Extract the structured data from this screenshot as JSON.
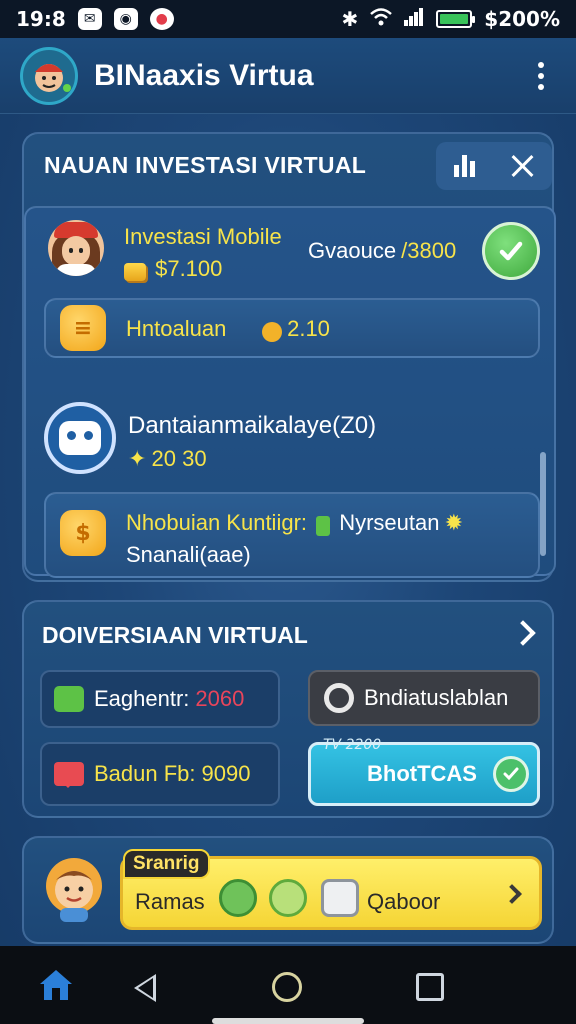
{
  "status_bar": {
    "time": "19:8",
    "battery": "$200%",
    "battery_level": 1.0
  },
  "app_bar": {
    "title": "BINaaxis Virtua"
  },
  "investment_panel": {
    "title": "NAUAN INVESTASI VIRTUAL",
    "main_card": {
      "name": "Investasi Mobile",
      "amount": "$7.100",
      "balance_label": "Gvaouce",
      "balance_value": "/3800"
    },
    "rows": [
      {
        "label": "Hntoaluan",
        "value": "2.10"
      },
      {
        "label": "Dantaianmaikalaye(Z0)",
        "value": "20 30"
      },
      {
        "label": "Nhobuian Kuntiigr:",
        "extra": "Nyrseutan",
        "sub": "Snanali(aae)"
      }
    ]
  },
  "conversion_panel": {
    "title": "DOIVERSIAAN VIRTUAL",
    "buttons": [
      {
        "label": "Eaghentr:",
        "value": "2060"
      },
      {
        "label": "Bndiatuslablan"
      },
      {
        "label": "Badun Fb:",
        "value": "9090"
      },
      {
        "tag": "TV 2200",
        "label": "BhotTCAS"
      }
    ]
  },
  "promo": {
    "tag": "Sranrig",
    "label": "Ramas",
    "action": "Qaboor"
  },
  "colors": {
    "accent_yellow": "#f7e34a",
    "accent_green": "#4cc06a",
    "accent_cyan": "#2ab1d8",
    "value_red": "#e8455b"
  }
}
